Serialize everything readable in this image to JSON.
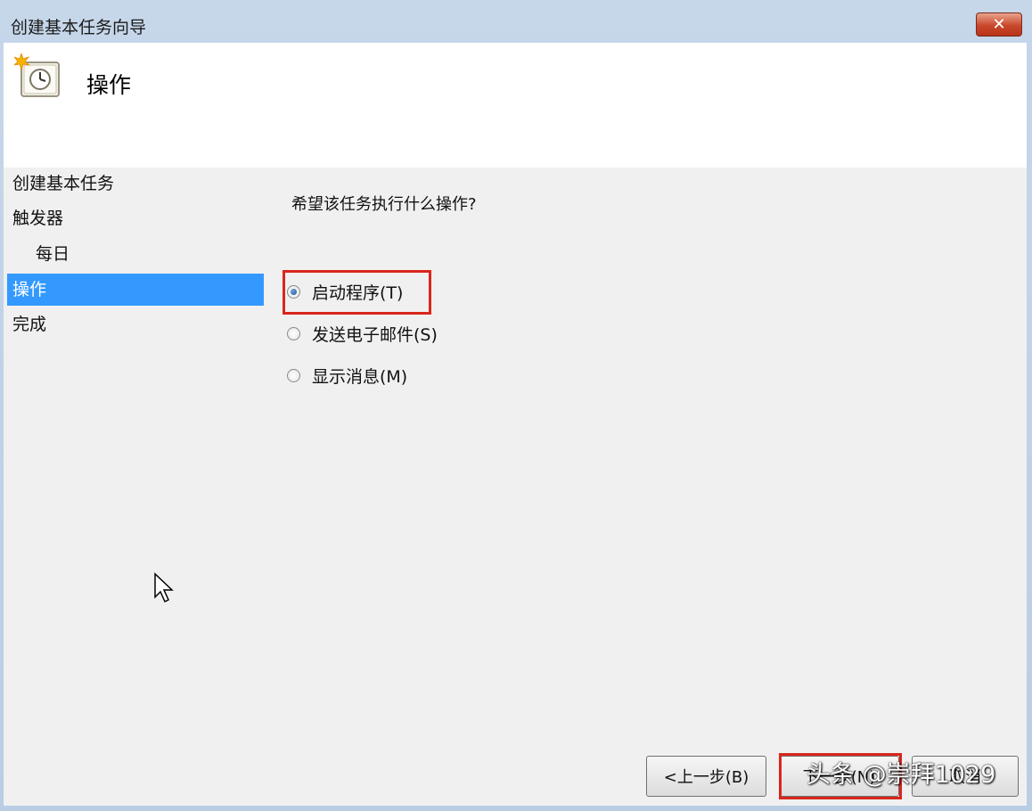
{
  "window": {
    "title": "创建基本任务向导",
    "close_label": "✕"
  },
  "header": {
    "title": "操作",
    "icon": "scheduled-task-clock-icon"
  },
  "nav": {
    "items": [
      {
        "label": "创建基本任务"
      },
      {
        "label": "触发器"
      },
      {
        "label": "每日"
      },
      {
        "label": "操作"
      },
      {
        "label": "完成"
      }
    ],
    "selected": "操作"
  },
  "content": {
    "question": "希望该任务执行什么操作?",
    "options": [
      {
        "label": "启动程序(T)",
        "selected": true
      },
      {
        "label": "发送电子邮件(S)",
        "selected": false
      },
      {
        "label": "显示消息(M)",
        "selected": false
      }
    ]
  },
  "buttons": {
    "back_label": "<上一步(B)",
    "next_label": "下一步(N)",
    "cancel_label": "取消"
  },
  "watermark": "头条 @崇拜1029",
  "colors": {
    "selection": "#3399ff",
    "highlight_box": "#d9261c"
  }
}
